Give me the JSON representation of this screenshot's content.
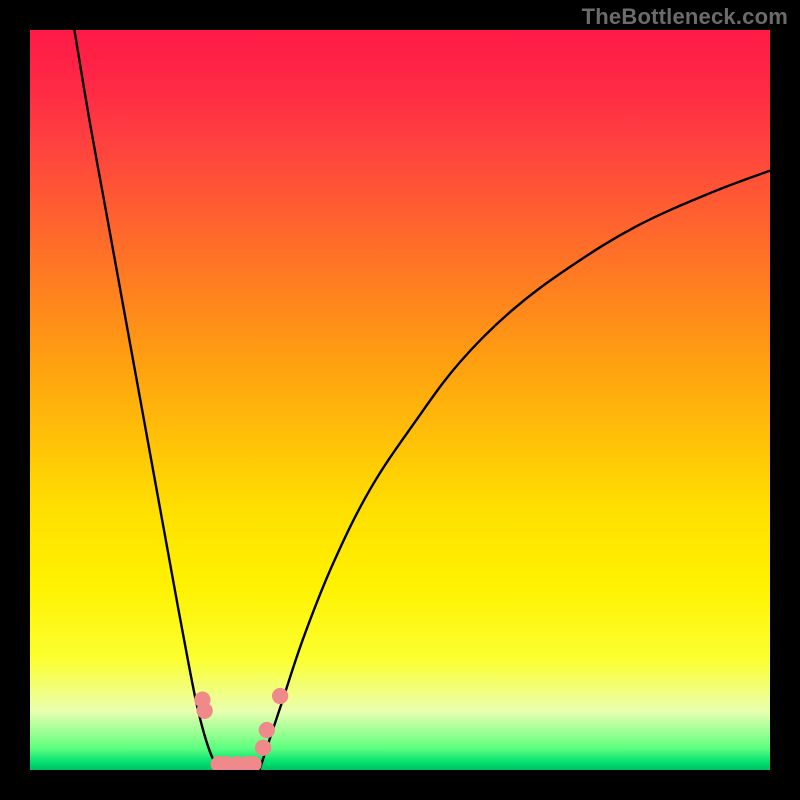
{
  "watermark": "TheBottleneck.com",
  "chart_data": {
    "type": "line",
    "title": "",
    "xlabel": "",
    "ylabel": "",
    "xlim": [
      0,
      100
    ],
    "ylim": [
      0,
      100
    ],
    "background_gradient": {
      "stops": [
        {
          "pos": 0,
          "color": "#ff1a45"
        },
        {
          "pos": 15,
          "color": "#ff4040"
        },
        {
          "pos": 35,
          "color": "#ff8020"
        },
        {
          "pos": 55,
          "color": "#ffc008"
        },
        {
          "pos": 75,
          "color": "#fff200"
        },
        {
          "pos": 92,
          "color": "#eaffb0"
        },
        {
          "pos": 100,
          "color": "#00c060"
        }
      ]
    },
    "series": [
      {
        "name": "left-branch",
        "x": [
          6,
          8,
          10,
          12,
          14,
          16,
          18,
          20,
          21.5,
          22.5,
          23.5,
          24.5,
          25.5
        ],
        "y": [
          100,
          88,
          77,
          66,
          55,
          44,
          33,
          22,
          14,
          9,
          5,
          2,
          0
        ]
      },
      {
        "name": "bottom-flat",
        "x": [
          25.5,
          26,
          27,
          28,
          29,
          30,
          31
        ],
        "y": [
          0,
          0,
          0,
          0,
          0,
          0,
          0
        ]
      },
      {
        "name": "right-branch",
        "x": [
          31,
          32,
          34,
          37,
          41,
          46,
          52,
          58,
          65,
          73,
          82,
          92,
          100
        ],
        "y": [
          0,
          3,
          9,
          18,
          28,
          38,
          47,
          55,
          62,
          68,
          73.5,
          78,
          81
        ]
      }
    ],
    "scatter_points": {
      "name": "highlighted-points",
      "color": "#f08a8a",
      "points": [
        {
          "x": 23.3,
          "y": 9.5,
          "r": 1.1
        },
        {
          "x": 23.6,
          "y": 8.0,
          "r": 1.1
        },
        {
          "x": 25.5,
          "y": 0.8,
          "r": 1.1
        },
        {
          "x": 26.6,
          "y": 0.8,
          "r": 1.1
        },
        {
          "x": 28.0,
          "y": 0.8,
          "r": 1.1
        },
        {
          "x": 29.4,
          "y": 0.8,
          "r": 1.1
        },
        {
          "x": 30.2,
          "y": 0.8,
          "r": 1.1
        },
        {
          "x": 31.5,
          "y": 3.0,
          "r": 1.1
        },
        {
          "x": 32.0,
          "y": 5.4,
          "r": 1.1
        },
        {
          "x": 33.8,
          "y": 10.0,
          "r": 1.1
        }
      ]
    }
  }
}
